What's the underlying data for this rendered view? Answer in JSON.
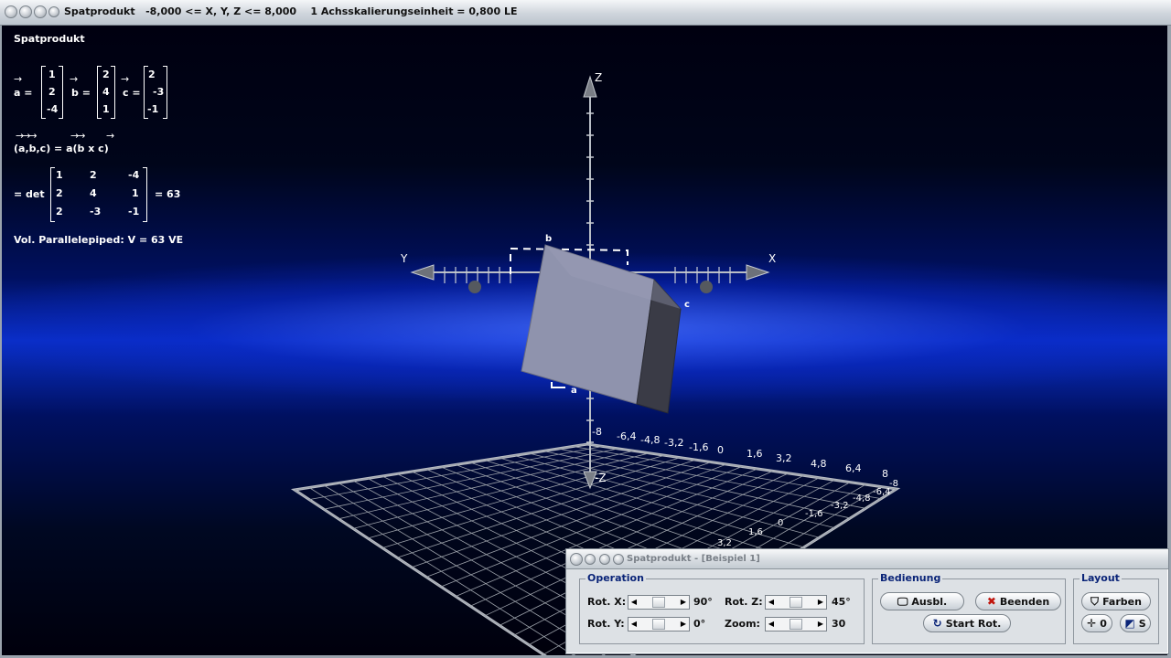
{
  "window": {
    "title": "Spatprodukt   -8,000 <= X, Y, Z <= 8,000    1 Achsskalierungseinheit = 0,800 LE"
  },
  "math": {
    "heading": "Spatprodukt",
    "vec_a_label": "a =",
    "vec_b_label": "b =",
    "vec_c_label": "c =",
    "vec_a": [
      "1",
      "2",
      "-4"
    ],
    "vec_b": [
      "2",
      "4",
      "1"
    ],
    "vec_c": [
      "2",
      "-3",
      "-1"
    ],
    "triple_label": "(a,b,c) = a(b x c)",
    "det_prefix": "= det",
    "det_rows": [
      [
        "1",
        "2",
        "-4"
      ],
      [
        "2",
        "4",
        "1"
      ],
      [
        "2",
        "-3",
        "-1"
      ]
    ],
    "det_result": "= 63",
    "volume": "Vol. Parallelepiped: V = 63 VE"
  },
  "axes": {
    "x_label": "X",
    "y_label": "Y",
    "z_label": "Z",
    "z_neg_label": "-Z",
    "z_ticks_label": "-8",
    "x_ticks": [
      "-6,4",
      "-4,8",
      "-3,2",
      "-1,6",
      "0",
      "1,6",
      "3,2",
      "4,8",
      "6,4",
      "8"
    ],
    "y_ticks": [
      "-8",
      "-6,4",
      "-4,8",
      "-3,2",
      "-1,6",
      "0",
      "1,6",
      "3,2"
    ],
    "point_a": "a",
    "point_b": "b",
    "point_c": "c"
  },
  "dialog": {
    "title": "Spatprodukt - [Beispiel 1]",
    "operation": {
      "label": "Operation",
      "rot_x_label": "Rot. X:",
      "rot_x_value": "90°",
      "rot_y_label": "Rot. Y:",
      "rot_y_value": "0°",
      "rot_z_label": "Rot. Z:",
      "rot_z_value": "45°",
      "zoom_label": "Zoom:",
      "zoom_value": "30"
    },
    "bedienung": {
      "label": "Bedienung",
      "ausbl": "Ausbl.",
      "beenden": "Beenden",
      "start_rot": "Start Rot."
    },
    "layout": {
      "label": "Layout",
      "farben": "Farben",
      "origin": "0",
      "s": "S"
    }
  },
  "colors": {
    "accent_red": "#c0140c",
    "group_label": "#0a2478",
    "cube_front": "#8f93ad",
    "cube_side": "#3a3b46"
  },
  "icons": {
    "ausbl": "monitor-hide-icon",
    "beenden": "close-x-icon",
    "start_rot": "rotate-icon",
    "farben": "paint-bucket-icon",
    "origin": "crosshair-icon",
    "s": "save-icon"
  }
}
